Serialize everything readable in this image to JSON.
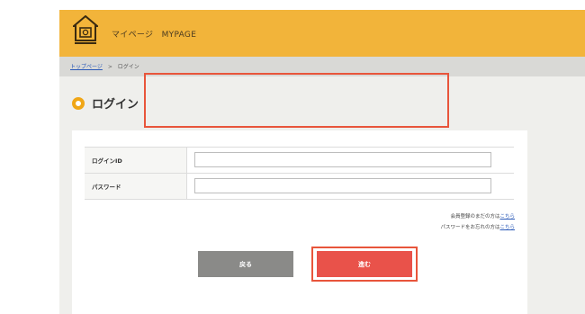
{
  "header": {
    "site_title": "マイページ　MYPAGE",
    "logo_icon": "house-camera-logo"
  },
  "breadcrumb": {
    "home": "トップページ",
    "separator": ">",
    "current": "ログイン"
  },
  "page": {
    "title": "ログイン"
  },
  "form": {
    "login_id_label": "ログインID",
    "login_id_value": "",
    "password_label": "パスワード",
    "password_value": ""
  },
  "help": {
    "register_text": "会員登録のまだの方は",
    "register_link": "こちら",
    "forgot_text": "パスワードをお忘れの方は",
    "forgot_link": "こちら"
  },
  "buttons": {
    "back_label": "戻る",
    "next_label": "進む"
  },
  "colors": {
    "header": "#f2b43a",
    "accent_ring": "#f0a616",
    "next_button": "#e9524a",
    "back_button": "#8a8a88",
    "highlight": "#e8553b"
  }
}
